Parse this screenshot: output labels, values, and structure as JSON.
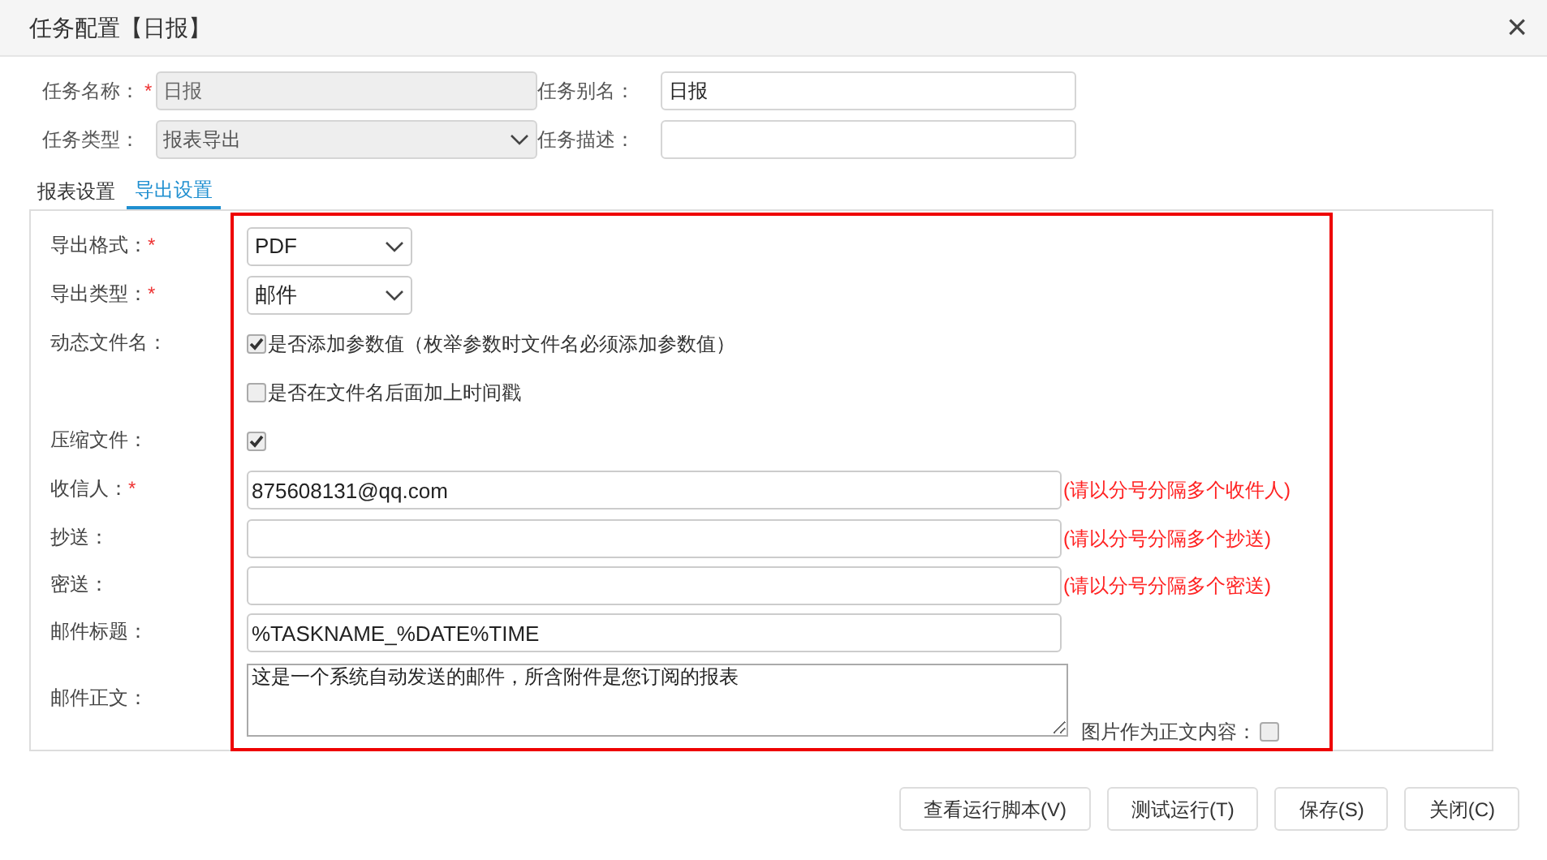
{
  "dialog": {
    "title": "任务配置【日报】",
    "close": "×"
  },
  "fields": [
    {
      "kind": "text",
      "label": "任务名称：",
      "required_mark": "*",
      "value": "日报",
      "disabled": true
    },
    {
      "kind": "text",
      "label": "任务别名：",
      "value": "日报",
      "disabled": false
    },
    {
      "kind": "select",
      "label": "任务类型：",
      "value": "报表导出",
      "disabled": true
    },
    {
      "kind": "text",
      "label": "任务描述：",
      "disabled": false
    }
  ],
  "tabs": [
    {
      "label": "报表设置",
      "selected": false
    },
    {
      "label": "导出设置",
      "selected": true
    }
  ],
  "export_settings": [
    {
      "kind": "select",
      "label": "导出格式：",
      "required_mark": "*",
      "value": "PDF"
    },
    {
      "kind": "select",
      "label": "导出类型：",
      "required_mark": "*",
      "value": "邮件"
    },
    {
      "kind": "checkbox",
      "label": "动态文件名：",
      "checked": true,
      "text": "是否添加参数值（枚举参数时文件名必须添加参数值）"
    },
    {
      "kind": "checkbox",
      "checked": false,
      "text": "是否在文件名后面加上时间戳"
    },
    {
      "kind": "checkbox",
      "label": "压缩文件：",
      "checked": true
    },
    {
      "kind": "text",
      "label": "收信人：",
      "required_mark": "*",
      "value": "875608131@qq.com",
      "hint": "(请以分号分隔多个收件人)"
    },
    {
      "kind": "text",
      "label": "抄送：",
      "hint": "(请以分号分隔多个抄送)"
    },
    {
      "kind": "text",
      "label": "密送：",
      "hint": "(请以分号分隔多个密送)"
    },
    {
      "kind": "text",
      "label": "邮件标题：",
      "value": "%TASKNAME_%DATE%TIME"
    },
    {
      "kind": "textarea",
      "label": "邮件正文：",
      "value": "这是一个系统自动发送的邮件，所含附件是您订阅的报表",
      "option": {
        "label": "图片作为正文内容：",
        "checked": false
      }
    }
  ],
  "buttons": [
    "查看运行脚本(V)",
    "测试运行(T)",
    "保存(S)",
    "关闭(C)"
  ]
}
